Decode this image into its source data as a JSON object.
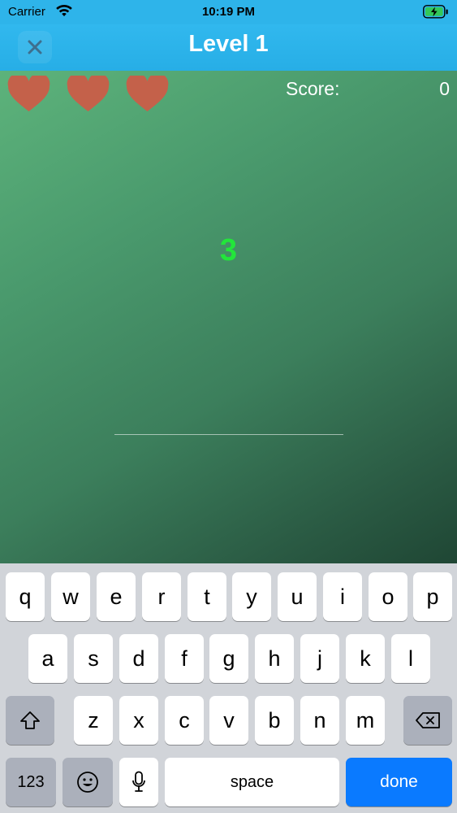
{
  "status_bar": {
    "carrier": "Carrier",
    "time": "10:19 PM",
    "wifi_icon": "wifi-icon",
    "battery_icon": "battery-charging-icon"
  },
  "nav": {
    "title": "Level 1",
    "close_icon": "close-icon"
  },
  "game": {
    "lives": 3,
    "heart_color": "#c4614a",
    "score_label": "Score:",
    "score_value": "0",
    "countdown": "3",
    "countdown_color": "#22e63a",
    "answer_value": ""
  },
  "keyboard": {
    "row1": [
      "q",
      "w",
      "e",
      "r",
      "t",
      "y",
      "u",
      "i",
      "o",
      "p"
    ],
    "row2": [
      "a",
      "s",
      "d",
      "f",
      "g",
      "h",
      "j",
      "k",
      "l"
    ],
    "row3": [
      "z",
      "x",
      "c",
      "v",
      "b",
      "n",
      "m"
    ],
    "numbers_label": "123",
    "space_label": "space",
    "done_label": "done",
    "shift_icon": "shift-icon",
    "delete_icon": "delete-icon",
    "emoji_icon": "emoji-icon",
    "mic_icon": "microphone-icon",
    "done_color": "#0a7aff"
  }
}
